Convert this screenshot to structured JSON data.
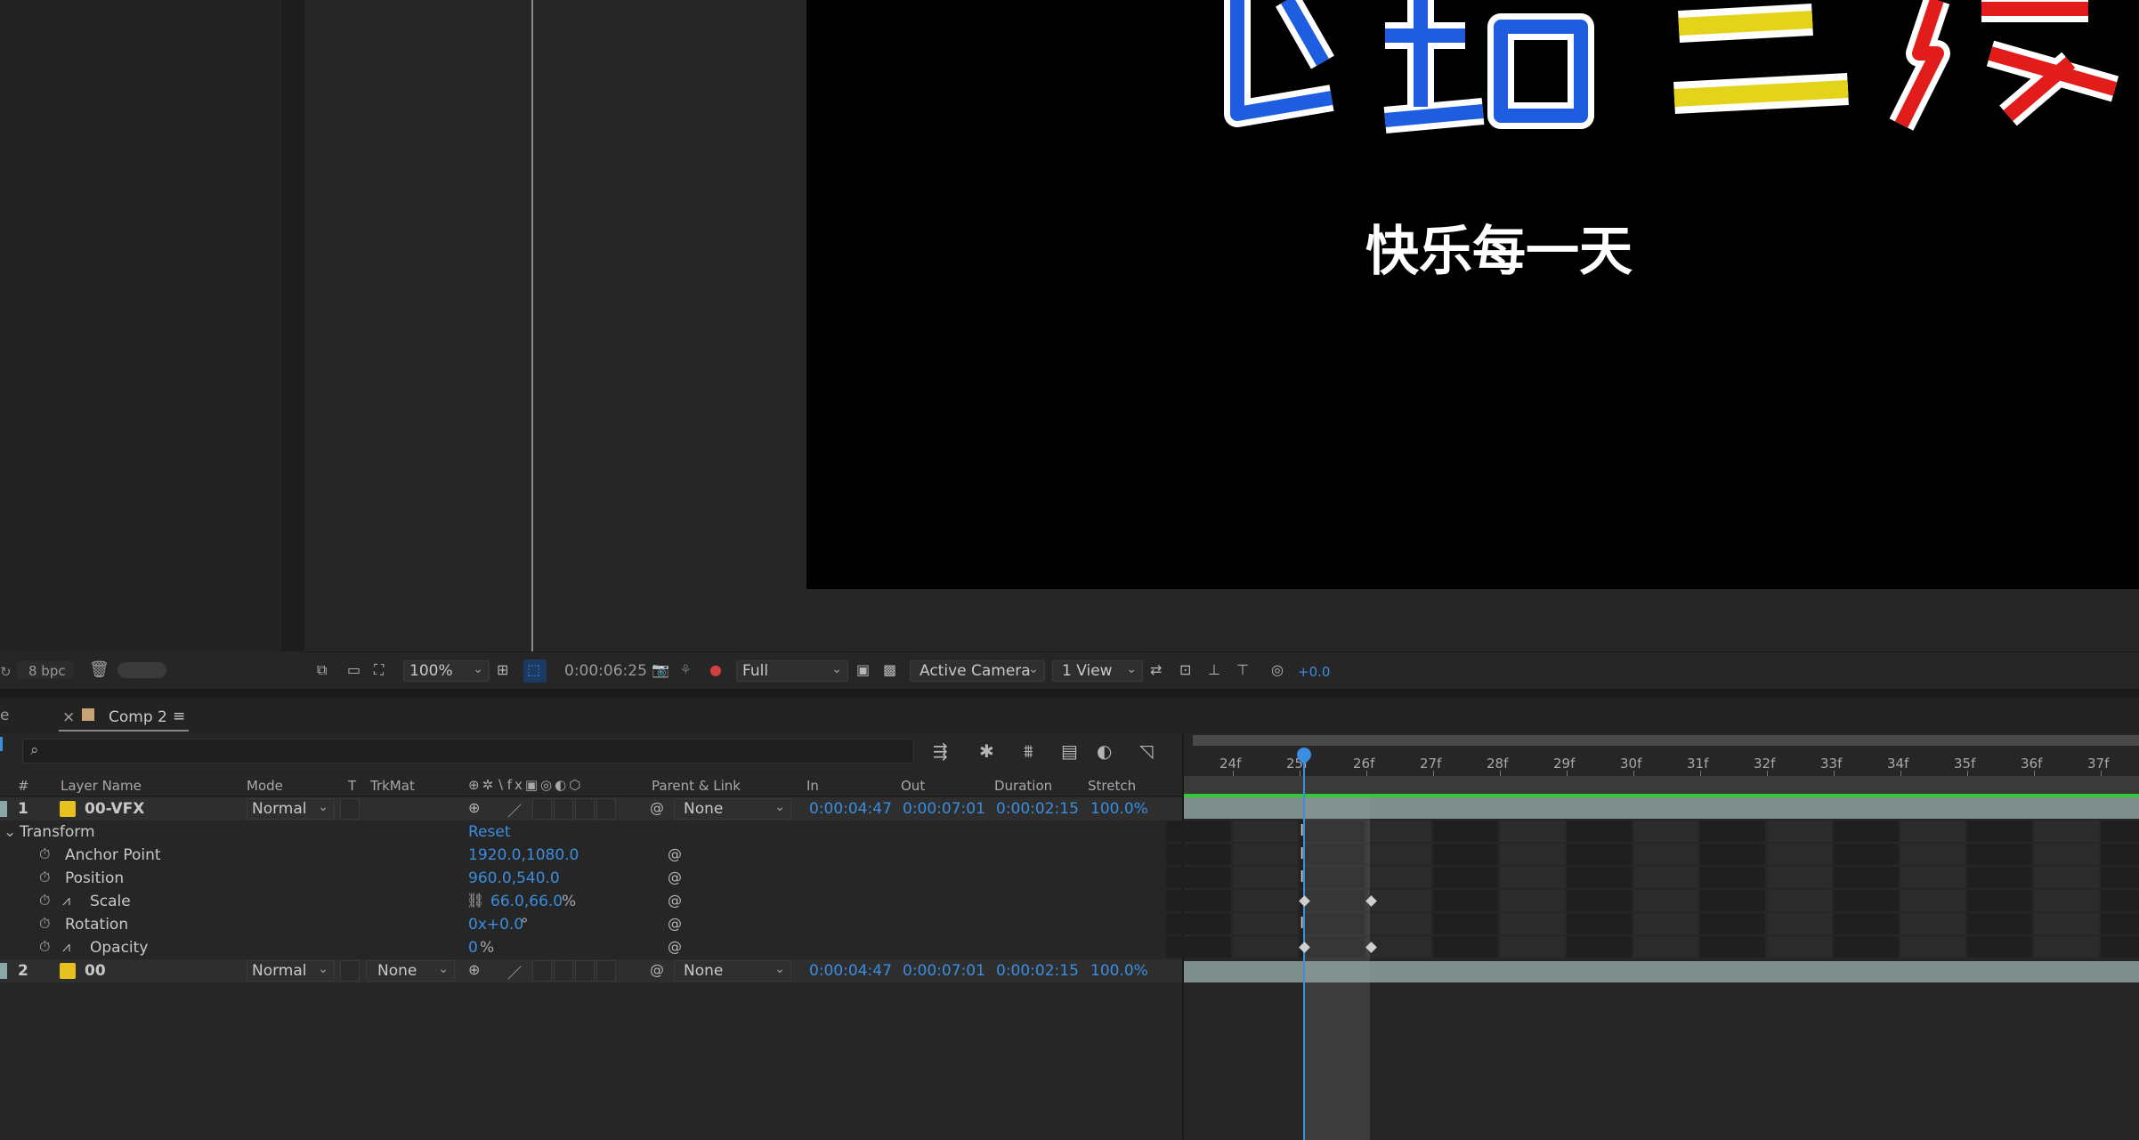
{
  "composition": {
    "title_chars": [
      "飞",
      "站",
      "三",
      "隧"
    ],
    "subtitle": "快乐每一天"
  },
  "left_bar": {
    "bpc": "8 bpc"
  },
  "viewer_bar": {
    "zoom": "100%",
    "timecode": "0:00:06:25",
    "resolution": "Full",
    "camera": "Active Camera",
    "views": "1 View",
    "exposure": "+0.0"
  },
  "timeline": {
    "tab_label": "Comp 2",
    "prev_tab_fragment": "e",
    "ruler": [
      "24f",
      "25f",
      "26f",
      "27f",
      "28f",
      "29f",
      "30f",
      "31f",
      "32f",
      "33f",
      "34f",
      "35f",
      "36f",
      "37f"
    ],
    "columns": {
      "num": "#",
      "layer_name": "Layer Name",
      "mode": "Mode",
      "t": "T",
      "trkmat": "TrkMat",
      "parent": "Parent & Link",
      "in": "In",
      "out": "Out",
      "duration": "Duration",
      "stretch": "Stretch"
    },
    "layers": [
      {
        "num": "1",
        "name": "00-VFX",
        "mode": "Normal",
        "trkmat": "",
        "parent": "None",
        "in": "0:00:04:47",
        "out": "0:00:07:01",
        "duration": "0:00:02:15",
        "stretch": "100.0%"
      },
      {
        "num": "2",
        "name": "00",
        "mode": "Normal",
        "trkmat": "None",
        "parent": "None",
        "in": "0:00:04:47",
        "out": "0:00:07:01",
        "duration": "0:00:02:15",
        "stretch": "100.0%"
      }
    ],
    "transform": {
      "label": "Transform",
      "reset": "Reset",
      "props": [
        {
          "name": "Anchor Point",
          "value": "1920.0,1080.0",
          "unit": ""
        },
        {
          "name": "Position",
          "value": "960.0,540.0",
          "unit": ""
        },
        {
          "name": "Scale",
          "value": "66.0,66.0",
          "unit": "%"
        },
        {
          "name": "Rotation",
          "value": "0x+0.0",
          "unit": "°"
        },
        {
          "name": "Opacity",
          "value": "0",
          "unit": "%"
        }
      ]
    }
  },
  "colors": {
    "accent_blue": "#3b8de0",
    "label_yellow": "#e8c21c",
    "work_area_green": "#35c835"
  }
}
